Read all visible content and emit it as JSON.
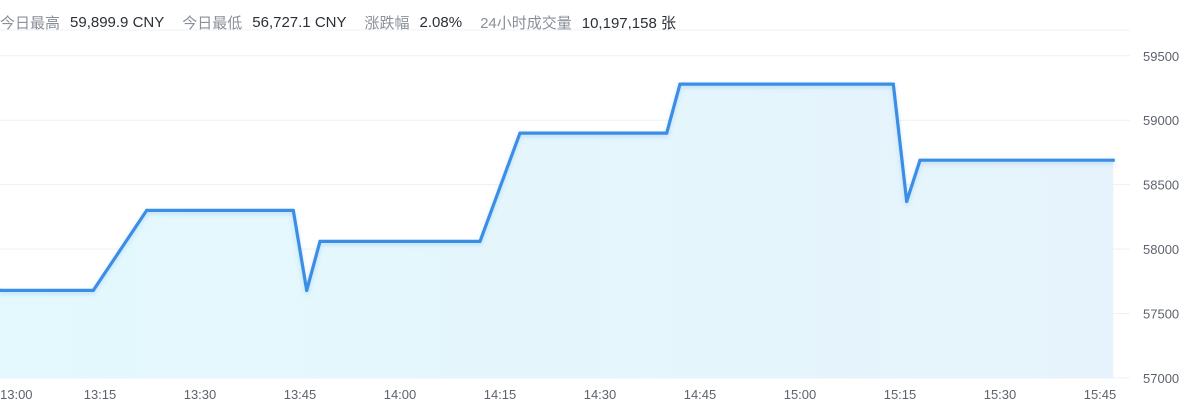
{
  "stats": [
    {
      "label": "今日最高",
      "value": "59,899.9 CNY"
    },
    {
      "label": "今日最低",
      "value": "56,727.1 CNY"
    },
    {
      "label": "涨跌幅",
      "value": "2.08%"
    },
    {
      "label": "24小时成交量",
      "value": "10,197,158 张"
    }
  ],
  "colors": {
    "line": "#3a8ee6",
    "fill_top": "#e6f3fc",
    "fill_bottom": "#e3f9fd",
    "grid": "#eef0f3"
  },
  "chart_data": {
    "type": "area",
    "x_ticks": [
      "13:00",
      "13:15",
      "13:30",
      "13:45",
      "14:00",
      "14:15",
      "14:30",
      "14:45",
      "15:00",
      "15:15",
      "15:30",
      "15:45"
    ],
    "y_ticks": [
      57000,
      57500,
      58000,
      58500,
      59000,
      59500
    ],
    "ylim": [
      57000,
      59700
    ],
    "xlim": [
      "13:00",
      "15:47"
    ],
    "y_axis_position": "right",
    "grid": "horizontal",
    "series": [
      {
        "points": [
          [
            "13:00",
            57680
          ],
          [
            "13:14",
            57680
          ],
          [
            "13:22",
            58300
          ],
          [
            "13:44",
            58300
          ],
          [
            "13:46",
            57680
          ],
          [
            "13:48",
            58060
          ],
          [
            "14:12",
            58060
          ],
          [
            "14:18",
            58900
          ],
          [
            "14:40",
            58900
          ],
          [
            "14:42",
            59280
          ],
          [
            "15:14",
            59280
          ],
          [
            "15:16",
            58370
          ],
          [
            "15:18",
            58690
          ],
          [
            "15:47",
            58690
          ]
        ]
      }
    ]
  }
}
